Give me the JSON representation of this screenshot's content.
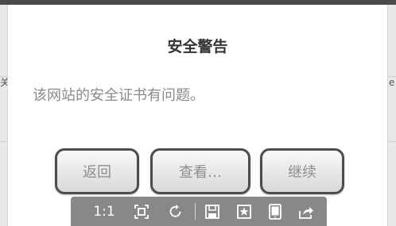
{
  "background": {
    "left_fragment": "关",
    "right_fragment": "e"
  },
  "dialog": {
    "title": "安全警告",
    "message": "该网站的安全证书有问题。",
    "buttons": {
      "back": "返回",
      "view": "查看…",
      "continue": "继续"
    }
  },
  "toolbar": {
    "zoom_label": "1:1",
    "icons": [
      "fit-screen-icon",
      "rotate-icon",
      "save-icon",
      "bookmark-star-icon",
      "tablet-icon",
      "share-icon"
    ]
  },
  "colors": {
    "dialog_bg": "#ffffff",
    "title": "#333333",
    "message": "#8a8a8a",
    "button_border": "#4d4d4d",
    "toolbar_bg": "#888888"
  }
}
